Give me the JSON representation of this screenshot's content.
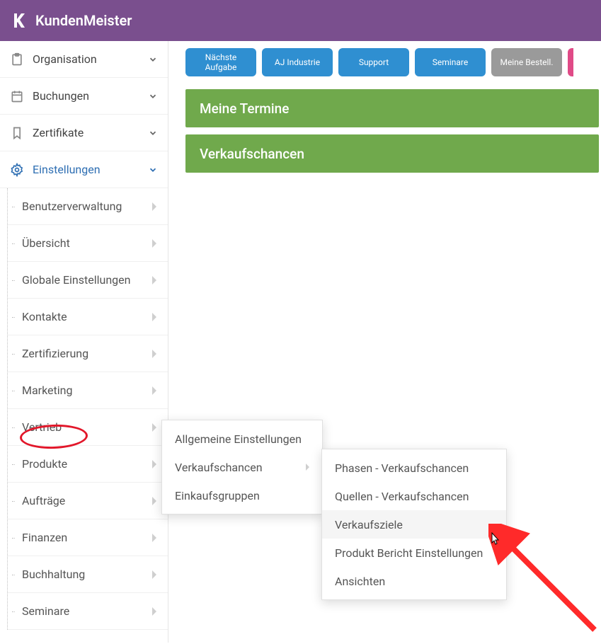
{
  "brand": "KundenMeister",
  "sidebar": {
    "organisation": "Organisation",
    "buchungen": "Buchungen",
    "zertifikate": "Zertifikate",
    "einstellungen": "Einstellungen",
    "sub": {
      "benutzerverwaltung": "Benutzerverwaltung",
      "uebersicht": "Übersicht",
      "globale": "Globale Einstellungen",
      "kontakte": "Kontakte",
      "zertifizierung": "Zertifizierung",
      "marketing": "Marketing",
      "vertrieb": "Vertrieb",
      "produkte": "Produkte",
      "auftraege": "Aufträge",
      "finanzen": "Finanzen",
      "buchhaltung": "Buchhaltung",
      "seminare": "Seminare"
    }
  },
  "tiles": {
    "naechste_aufgabe": "Nächste Aufgabe",
    "aj_industrie": "AJ Industrie",
    "support": "Support",
    "seminare": "Seminare",
    "meine_bestell": "Meine Bestell."
  },
  "panels": {
    "meine_termine": "Meine Termine",
    "verkaufschancen": "Verkaufschancen"
  },
  "flyout1": {
    "allgemeine": "Allgemeine Einstellungen",
    "verkaufschancen": "Verkaufschancen",
    "einkaufsgruppen": "Einkaufsgruppen"
  },
  "flyout2": {
    "phasen": "Phasen - Verkaufschancen",
    "quellen": "Quellen - Verkaufschancen",
    "verkaufsziele": "Verkaufsziele",
    "produkt_bericht": "Produkt Bericht Einstellungen",
    "ansichten": "Ansichten"
  }
}
